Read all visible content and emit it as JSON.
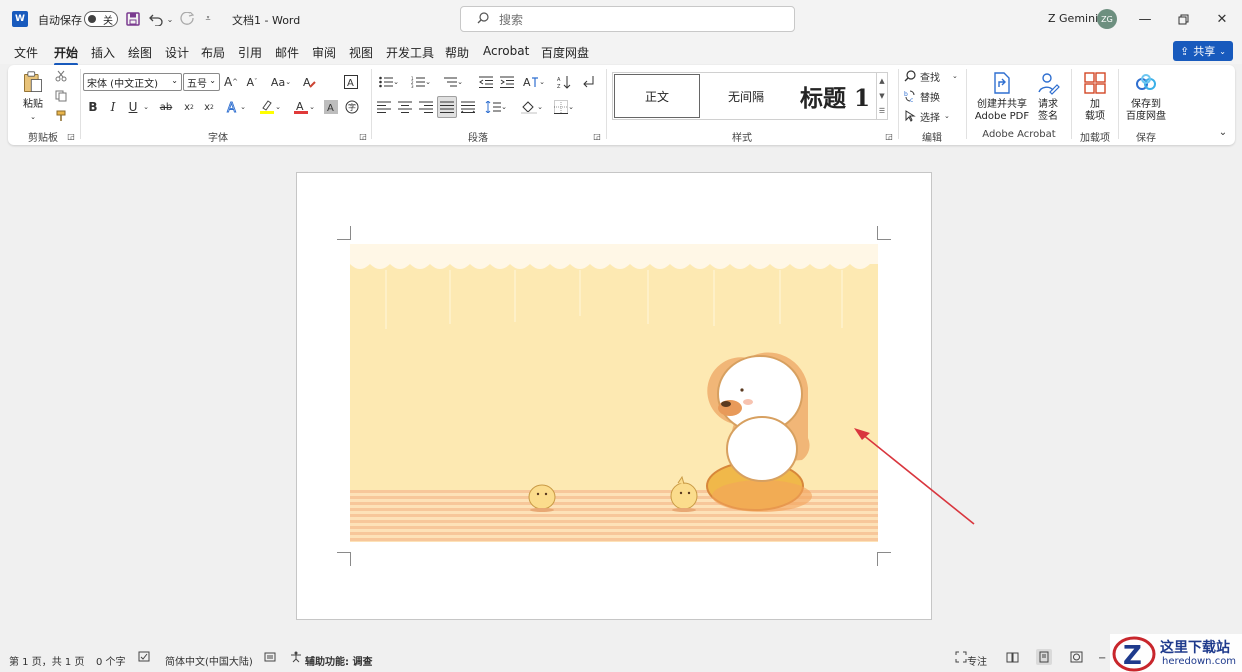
{
  "titlebar": {
    "autosave_label": "自动保存",
    "autosave_state": "关",
    "doc_title": "文档1  -  Word",
    "search_placeholder": "搜索",
    "user_name": "Z Gemini",
    "user_initials": "ZG"
  },
  "menu": {
    "tabs": [
      "文件",
      "开始",
      "插入",
      "绘图",
      "设计",
      "布局",
      "引用",
      "邮件",
      "审阅",
      "视图",
      "开发工具",
      "帮助",
      "Acrobat",
      "百度网盘"
    ],
    "active": "开始",
    "share_label": "共享"
  },
  "ribbon": {
    "clipboard": {
      "paste_label": "粘贴",
      "group_label": "剪贴板"
    },
    "font": {
      "font_name": "宋体 (中文正文)",
      "font_size": "五号",
      "group_label": "字体",
      "bold": "B",
      "italic": "I",
      "underline": "U",
      "grow": "A",
      "shrink": "A",
      "change_case": "Aa"
    },
    "paragraph": {
      "group_label": "段落"
    },
    "styles": {
      "items": [
        "正文",
        "无间隔",
        "标题 1"
      ],
      "group_label": "样式"
    },
    "editing": {
      "find": "查找",
      "replace": "替换",
      "select": "选择",
      "group_label": "编辑"
    },
    "acrobat": {
      "create_share": [
        "创建并共享",
        "Adobe PDF"
      ],
      "request_sign": [
        "请求",
        "签名"
      ],
      "group_label": "Adobe Acrobat"
    },
    "addins": {
      "button": [
        "加",
        "载项"
      ],
      "group_label": "加载项"
    },
    "save": {
      "button": [
        "保存到",
        "百度网盘"
      ],
      "group_label": "保存"
    }
  },
  "statusbar": {
    "page": "第 1 页，共 1 页",
    "words": "0 个字",
    "language": "简体中文(中国大陆)",
    "accessibility": "辅助功能: 调查",
    "focus": "专注"
  },
  "watermark": {
    "title": "这里下载站",
    "url": "heredown.com"
  },
  "colors": {
    "accent": "#185abd",
    "picture_bg": "#fde9b2",
    "arrow": "#d9363e"
  }
}
